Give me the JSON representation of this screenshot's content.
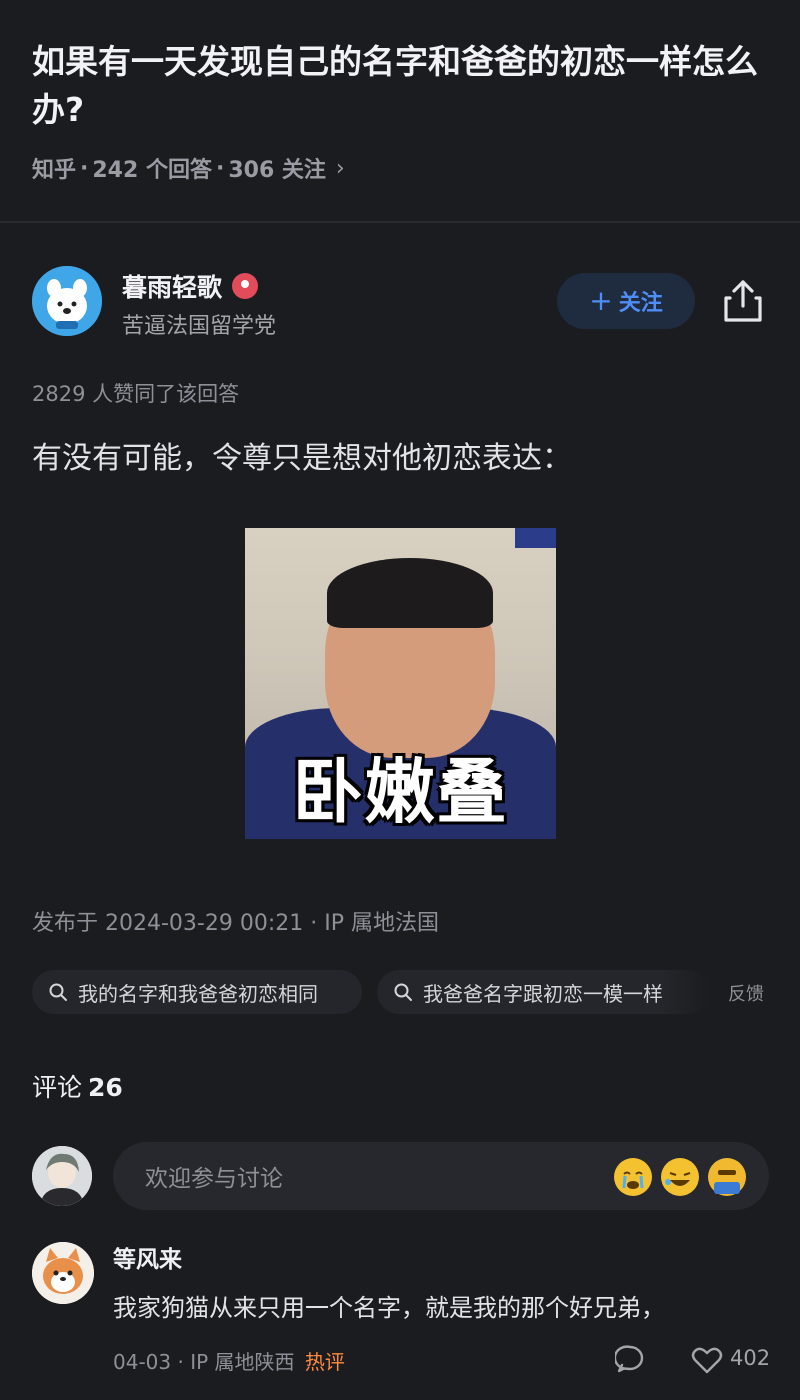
{
  "question": {
    "title": "如果有一天发现自己的名字和爸爸的初恋一样怎么办?",
    "source": "知乎",
    "answers_count": "242 个回答",
    "followers_count": "306 关注",
    "separator": "·",
    "chevron": "›"
  },
  "author": {
    "name": "暮雨轻歌",
    "bio": "苦逼法国留学党",
    "follow_label": "关注",
    "follow_plus": "+"
  },
  "answer": {
    "votes": "2829 人赞同了该回答",
    "text": "有没有可能，令尊只是想对他初恋表达：",
    "image_caption": "卧嫩叠",
    "image_watermark_left": "",
    "image_watermark_right": "",
    "image_pub_tag": "",
    "published": "发布于 2024-03-29 00:21 · IP 属地法国"
  },
  "search_chips": [
    {
      "label": "我的名字和我爸爸初恋相同"
    },
    {
      "label": "我爸爸名字跟初恋一模一样"
    }
  ],
  "feedback_label": "反馈",
  "comments": {
    "title": "评论",
    "count": "26",
    "input_placeholder": "欢迎参与讨论",
    "items": [
      {
        "user": "等风来",
        "text": "我家狗猫从来只用一个名字，就是我的那个好兄弟，",
        "date": "04-03 ·",
        "ip": "IP 属地陕西",
        "hot": "热评",
        "likes": "402"
      }
    ]
  },
  "colors": {
    "background": "#1b1c20",
    "accent_blue": "#4f8df7",
    "hot_orange": "#ff8a3c"
  }
}
